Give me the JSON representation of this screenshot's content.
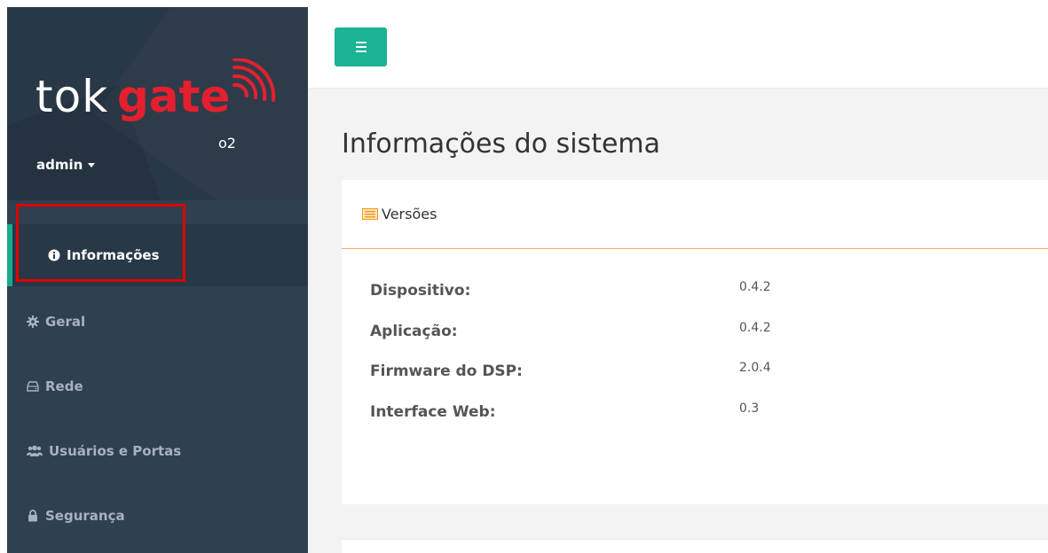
{
  "app": {
    "logo": {
      "tok": "tok",
      "gate": "gate",
      "suffix": "o2"
    },
    "user": {
      "name": "admin"
    }
  },
  "sidebar": {
    "items": [
      {
        "label": "Informações",
        "icon": "info-icon",
        "active": true
      },
      {
        "label": "Geral",
        "icon": "gear-icon"
      },
      {
        "label": "Rede",
        "icon": "hdd-icon"
      },
      {
        "label": "Usuários e Portas",
        "icon": "users-icon"
      },
      {
        "label": "Segurança",
        "icon": "lock-icon"
      }
    ]
  },
  "main": {
    "page_title": "Informações do sistema",
    "panel": {
      "title": "Versões",
      "icon": "list-icon",
      "rows": [
        {
          "label": "Dispositivo:",
          "value": "0.4.2"
        },
        {
          "label": "Aplicação:",
          "value": "0.4.2"
        },
        {
          "label": "Firmware do DSP:",
          "value": "2.0.4"
        },
        {
          "label": "Interface Web:",
          "value": "0.3"
        }
      ]
    }
  },
  "colors": {
    "sidebar_bg": "#2f4050",
    "active_bg": "#293846",
    "accent_green": "#1ab394",
    "brand_red": "#e4202e",
    "panel_underline": "#f8ac59",
    "highlight_red": "#e00000"
  }
}
